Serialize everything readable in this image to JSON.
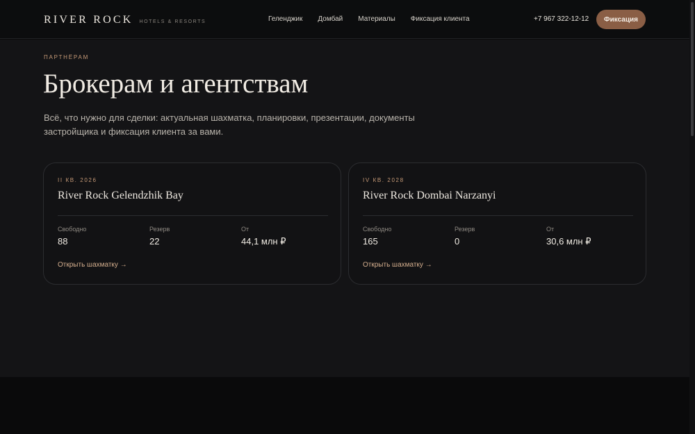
{
  "header": {
    "logo": {
      "name": "RIVER ROCK",
      "tagline": "HOTELS & RESORTS"
    },
    "nav": [
      {
        "label": "Геленджик"
      },
      {
        "label": "Домбай"
      },
      {
        "label": "Материалы"
      },
      {
        "label": "Фиксация клиента"
      }
    ],
    "phone": "+7 967 322-12-12",
    "cta_label": "Фиксация"
  },
  "hero": {
    "eyebrow": "ПАРТНЁРАМ",
    "title": "Брокерам и агентствам",
    "description": "Всё, что нужно для сделки: актуальная шахматка, планировки, презентации, документы застройщика и фиксация клиента за вами."
  },
  "projects": [
    {
      "period": "II КВ. 2026",
      "name": "River Rock Gelendzhik Bay",
      "stats": [
        {
          "label": "Свободно",
          "value": "88"
        },
        {
          "label": "Резерв",
          "value": "22"
        },
        {
          "label": "От",
          "value": "44,1 млн ₽"
        }
      ],
      "link": "Открыть шахматку →"
    },
    {
      "period": "IV КВ. 2028",
      "name": "River Rock Dombai Narzanyi",
      "stats": [
        {
          "label": "Свободно",
          "value": "165"
        },
        {
          "label": "Резерв",
          "value": "0"
        },
        {
          "label": "От",
          "value": "30,6 млн ₽"
        }
      ],
      "link": "Открыть шахматку →"
    }
  ],
  "colors": {
    "accent": "#c69a77",
    "cta_background": "#8a5e45",
    "page_background": "#141416",
    "header_background": "#0c0d0e"
  }
}
